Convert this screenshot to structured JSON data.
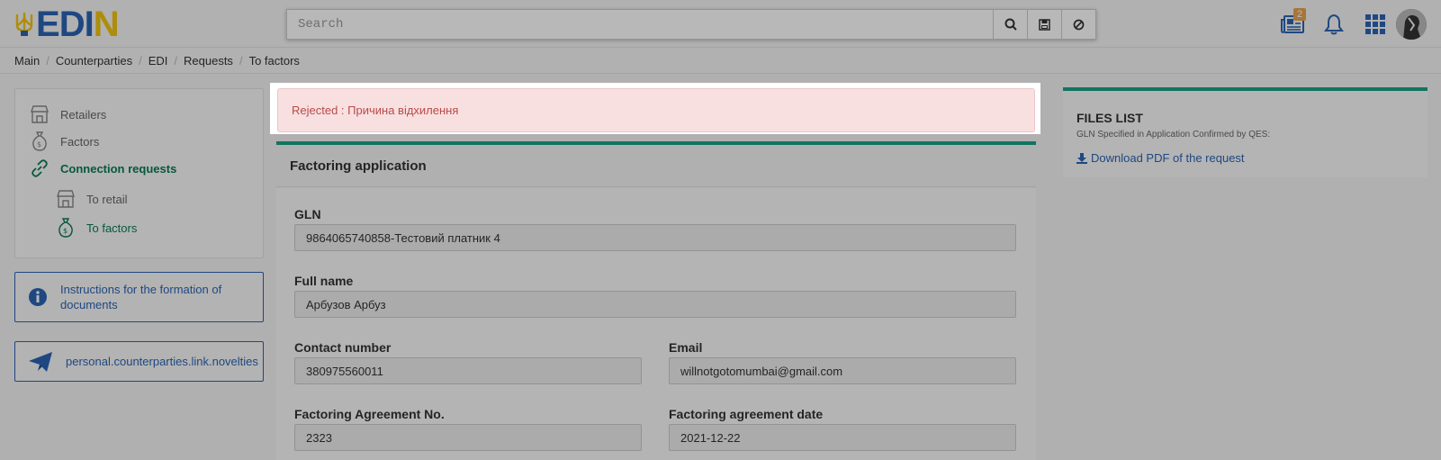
{
  "header": {
    "logo_text": "EDIN",
    "search": {
      "placeholder": "Search",
      "value": ""
    },
    "notifications_badge": "2",
    "icons": [
      "search-icon",
      "save-icon",
      "clear-icon",
      "news-icon",
      "bell-icon",
      "apps-grid-icon",
      "avatar"
    ]
  },
  "breadcrumb": [
    "Main",
    "Counterparties",
    "EDI",
    "Requests",
    "To factors"
  ],
  "sidebar": {
    "items": [
      {
        "label": "Retailers",
        "icon": "store-icon"
      },
      {
        "label": "Factors",
        "icon": "money-bag-icon"
      },
      {
        "label": "Connection requests",
        "icon": "link-icon"
      },
      {
        "label": "To retail",
        "icon": "store-icon"
      },
      {
        "label": "To factors",
        "icon": "money-bag-icon"
      }
    ],
    "instructions_label": "Instructions for the formation of documents",
    "novelties_label": "personal.counterparties.link.novelties"
  },
  "alert": {
    "text": "Rejected : Причина відхилення"
  },
  "application": {
    "title": "Factoring application",
    "gln_label": "GLN",
    "gln_value": "9864065740858-Тестовий платник 4",
    "fullname_label": "Full name",
    "fullname_value": "Арбузов Арбуз",
    "contact_label": "Contact number",
    "contact_value": "380975560011",
    "email_label": "Email",
    "email_value": "willnotgotomumbai@gmail.com",
    "agreement_no_label": "Factoring Agreement No.",
    "agreement_no_value": "2323",
    "agreement_date_label": "Factoring agreement date",
    "agreement_date_value": "2021-12-22"
  },
  "files": {
    "title": "FILES LIST",
    "subtitle": "GLN Specified in Application Confirmed by QES:",
    "download_label": "Download PDF of the request"
  },
  "colors": {
    "brand_blue": "#2b65b5",
    "brand_yellow": "#f1c40f",
    "accent_green": "#19a087",
    "active_green": "#0b7a55",
    "alert_bg": "#f8e0e1",
    "alert_text": "#b94a48",
    "badge": "#e8a44f"
  }
}
